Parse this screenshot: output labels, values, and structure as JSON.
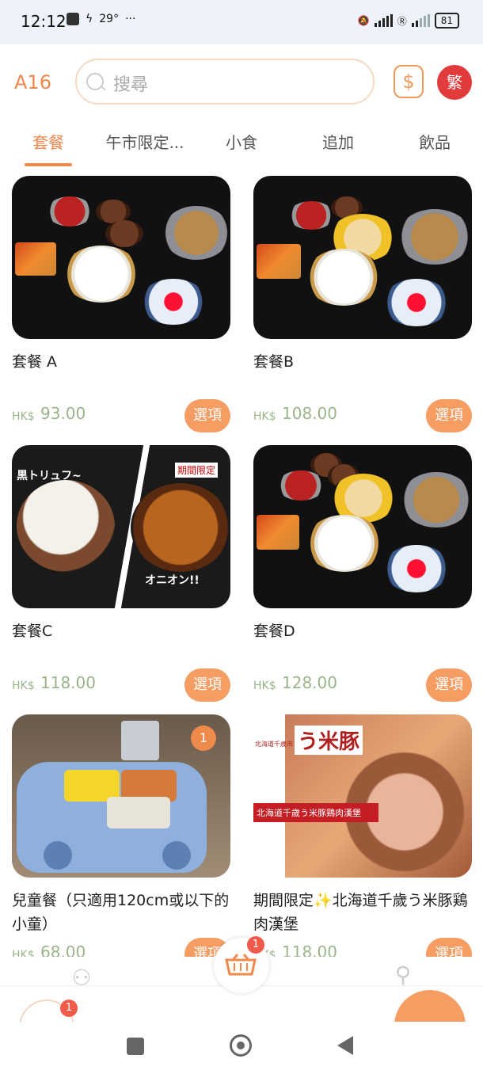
{
  "status_bar": {
    "time": "12:12",
    "temp": "29°",
    "dots": "···",
    "battery": "81"
  },
  "header": {
    "table_no": "A16",
    "search_placeholder": "搜尋",
    "coin_icon": "dollar-icon",
    "lang_label": "繁"
  },
  "tabs": [
    {
      "label": "套餐",
      "active": true
    },
    {
      "label": "午市限定..."
    },
    {
      "label": "小食"
    },
    {
      "label": "追加"
    },
    {
      "label": "飲品"
    }
  ],
  "currency": "HK$",
  "option_label": "選項",
  "items": [
    {
      "name": "套餐 A",
      "price": "93.00"
    },
    {
      "name": "套餐B",
      "price": "108.00"
    },
    {
      "name": "套餐C",
      "price": "118.00",
      "img_text_left": "黒トリュフ~",
      "img_text_right": "期間限定",
      "img_text_bottom": "オニオン!!"
    },
    {
      "name": "套餐D",
      "price": "128.00"
    },
    {
      "name": "兒童餐（只適用120cm或以下的小童）",
      "price": "68.00",
      "qty": "1"
    },
    {
      "name": "期間限定✨北海道千歲う米豚鶏肉漢堡",
      "price": "118.00",
      "img_brand": "う米豚",
      "img_brand_small": "北海道千歲市",
      "img_banner": "北海道千歲う米豚鶏肉漢堡"
    }
  ],
  "cart_count": "1",
  "left_fab_count": "1"
}
